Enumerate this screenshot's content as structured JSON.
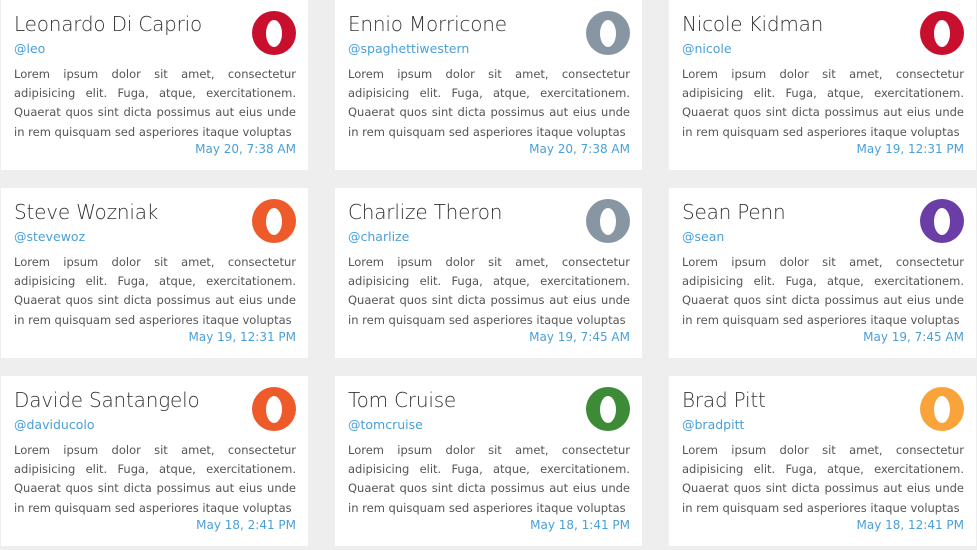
{
  "cards": [
    {
      "name": "Leonardo Di Caprio",
      "handle": "@leo",
      "body": "Lorem ipsum dolor sit amet, consectetur adipisicing elit. Fuga, atque, exercitationem. Quaerat quos sint dicta possimus aut eius unde in rem quisquam sed asperiores itaque voluptas",
      "time": "May 20, 7:38 AM",
      "avatar_color": "#c8102e"
    },
    {
      "name": "Ennio Morricone",
      "handle": "@spaghettiwestern",
      "body": "Lorem ipsum dolor sit amet, consectetur adipisicing elit. Fuga, atque, exercitationem. Quaerat quos sint dicta possimus aut eius unde in rem quisquam sed asperiores itaque voluptas",
      "time": "May 20, 7:38 AM",
      "avatar_color": "#8796a2"
    },
    {
      "name": "Nicole Kidman",
      "handle": "@nicole",
      "body": "Lorem ipsum dolor sit amet, consectetur adipisicing elit. Fuga, atque, exercitationem. Quaerat quos sint dicta possimus aut eius unde in rem quisquam sed asperiores itaque voluptas",
      "time": "May 19, 12:31 PM",
      "avatar_color": "#c8102e"
    },
    {
      "name": "Steve Wozniak",
      "handle": "@stevewoz",
      "body": "Lorem ipsum dolor sit amet, consectetur adipisicing elit. Fuga, atque, exercitationem. Quaerat quos sint dicta possimus aut eius unde in rem quisquam sed asperiores itaque voluptas",
      "time": "May 19, 12:31 PM",
      "avatar_color": "#ef5a2a"
    },
    {
      "name": "Charlize Theron",
      "handle": "@charlize",
      "body": "Lorem ipsum dolor sit amet, consectetur adipisicing elit. Fuga, atque, exercitationem. Quaerat quos sint dicta possimus aut eius unde in rem quisquam sed asperiores itaque voluptas",
      "time": "May 19, 7:45 AM",
      "avatar_color": "#8796a2"
    },
    {
      "name": "Sean Penn",
      "handle": "@sean",
      "body": "Lorem ipsum dolor sit amet, consectetur adipisicing elit. Fuga, atque, exercitationem. Quaerat quos sint dicta possimus aut eius unde in rem quisquam sed asperiores itaque voluptas",
      "time": "May 19, 7:45 AM",
      "avatar_color": "#6a3ea6"
    },
    {
      "name": "Davide Santangelo",
      "handle": "@daviducolo",
      "body": "Lorem ipsum dolor sit amet, consectetur adipisicing elit. Fuga, atque, exercitationem. Quaerat quos sint dicta possimus aut eius unde in rem quisquam sed asperiores itaque voluptas",
      "time": "May 18, 2:41 PM",
      "avatar_color": "#ef5a2a"
    },
    {
      "name": "Tom Cruise",
      "handle": "@tomcruise",
      "body": "Lorem ipsum dolor sit amet, consectetur adipisicing elit. Fuga, atque, exercitationem. Quaerat quos sint dicta possimus aut eius unde in rem quisquam sed asperiores itaque voluptas",
      "time": "May 18, 1:41 PM",
      "avatar_color": "#3d8a37"
    },
    {
      "name": "Brad Pitt",
      "handle": "@bradpitt",
      "body": "Lorem ipsum dolor sit amet, consectetur adipisicing elit. Fuga, atque, exercitationem. Quaerat quos sint dicta possimus aut eius unde in rem quisquam sed asperiores itaque voluptas",
      "time": "May 18, 12:41 PM",
      "avatar_color": "#f9a43a"
    }
  ]
}
